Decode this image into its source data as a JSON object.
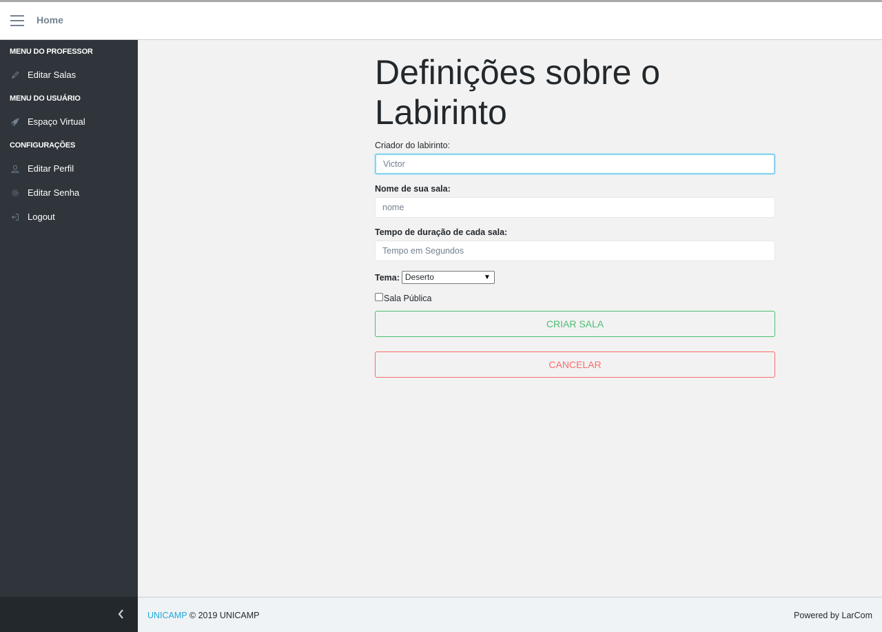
{
  "header": {
    "home_label": "Home"
  },
  "sidebar": {
    "sections": [
      {
        "title": "MENU DO PROFESSOR",
        "items": [
          {
            "label": "Editar Salas",
            "icon": "pencil-icon"
          }
        ]
      },
      {
        "title": "MENU DO USUÁRIO",
        "items": [
          {
            "label": "Espaço Virtual",
            "icon": "rocket-icon"
          }
        ]
      },
      {
        "title": "CONFIGURAÇÕES",
        "items": [
          {
            "label": "Editar Perfil",
            "icon": "user-icon"
          },
          {
            "label": "Editar Senha",
            "icon": "gear-icon"
          },
          {
            "label": "Logout",
            "icon": "logout-icon"
          }
        ]
      }
    ]
  },
  "page": {
    "title": "Definições sobre o Labirinto"
  },
  "form": {
    "creator_label": "Criador do labirinto:",
    "creator_placeholder": "Victor",
    "room_name_label": "Nome de sua sala:",
    "room_name_placeholder": "nome",
    "duration_label": "Tempo de duração de cada sala:",
    "duration_placeholder": "Tempo em Segundos",
    "theme_label": "Tema:",
    "theme_value": "Deserto",
    "public_label": "Sala Pública",
    "create_label": "CRIAR SALA",
    "cancel_label": "CANCELAR"
  },
  "footer": {
    "brand_link": "UNICAMP",
    "copyright": "© 2019 UNICAMP",
    "powered_by": "Powered by LarCom"
  },
  "colors": {
    "sidebar_bg": "#2f353a",
    "success": "#4dbd74",
    "danger": "#f86c6b",
    "link": "#20a8d8"
  }
}
